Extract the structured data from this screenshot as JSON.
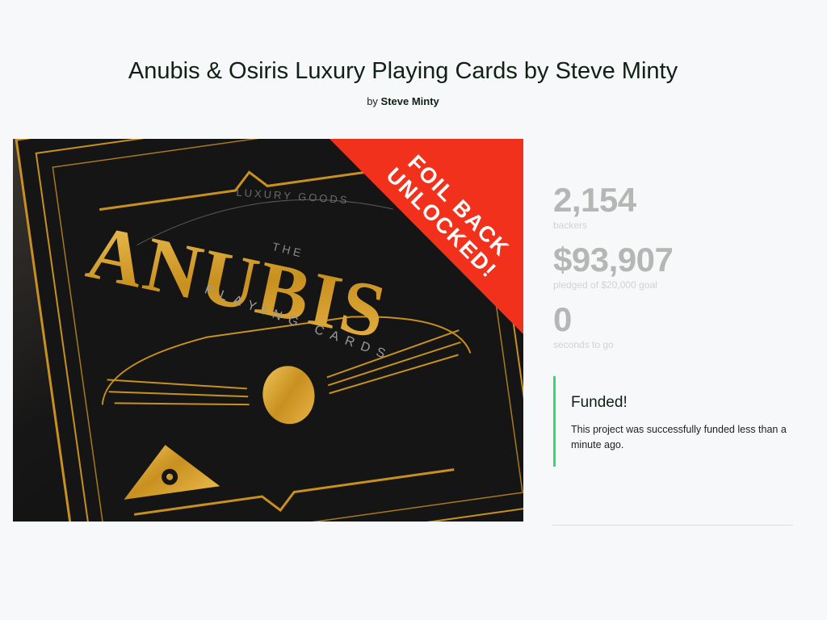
{
  "project": {
    "title": "Anubis & Osiris Luxury Playing Cards by Steve Minty",
    "by_prefix": "by",
    "creator": "Steve Minty"
  },
  "hero": {
    "banner_line1": "FOIL BACK",
    "banner_line2": "UNLOCKED!",
    "brand_top": "LUXURY GOODS",
    "brand_the": "THE",
    "brand_name": "ANUBIS",
    "brand_sub": "PLAYING CARDS",
    "banner_color": "#f2311c",
    "gold_color": "#d4a230"
  },
  "stats": {
    "backers_count": "2,154",
    "backers_label": "backers",
    "pledged_amount": "$93,907",
    "pledged_label": "pledged of $20,000 goal",
    "time_value": "0",
    "time_label": "seconds to go"
  },
  "funded": {
    "title": "Funded!",
    "message": "This project was successfully funded less than a minute ago.",
    "accent_color": "#2bde73"
  }
}
